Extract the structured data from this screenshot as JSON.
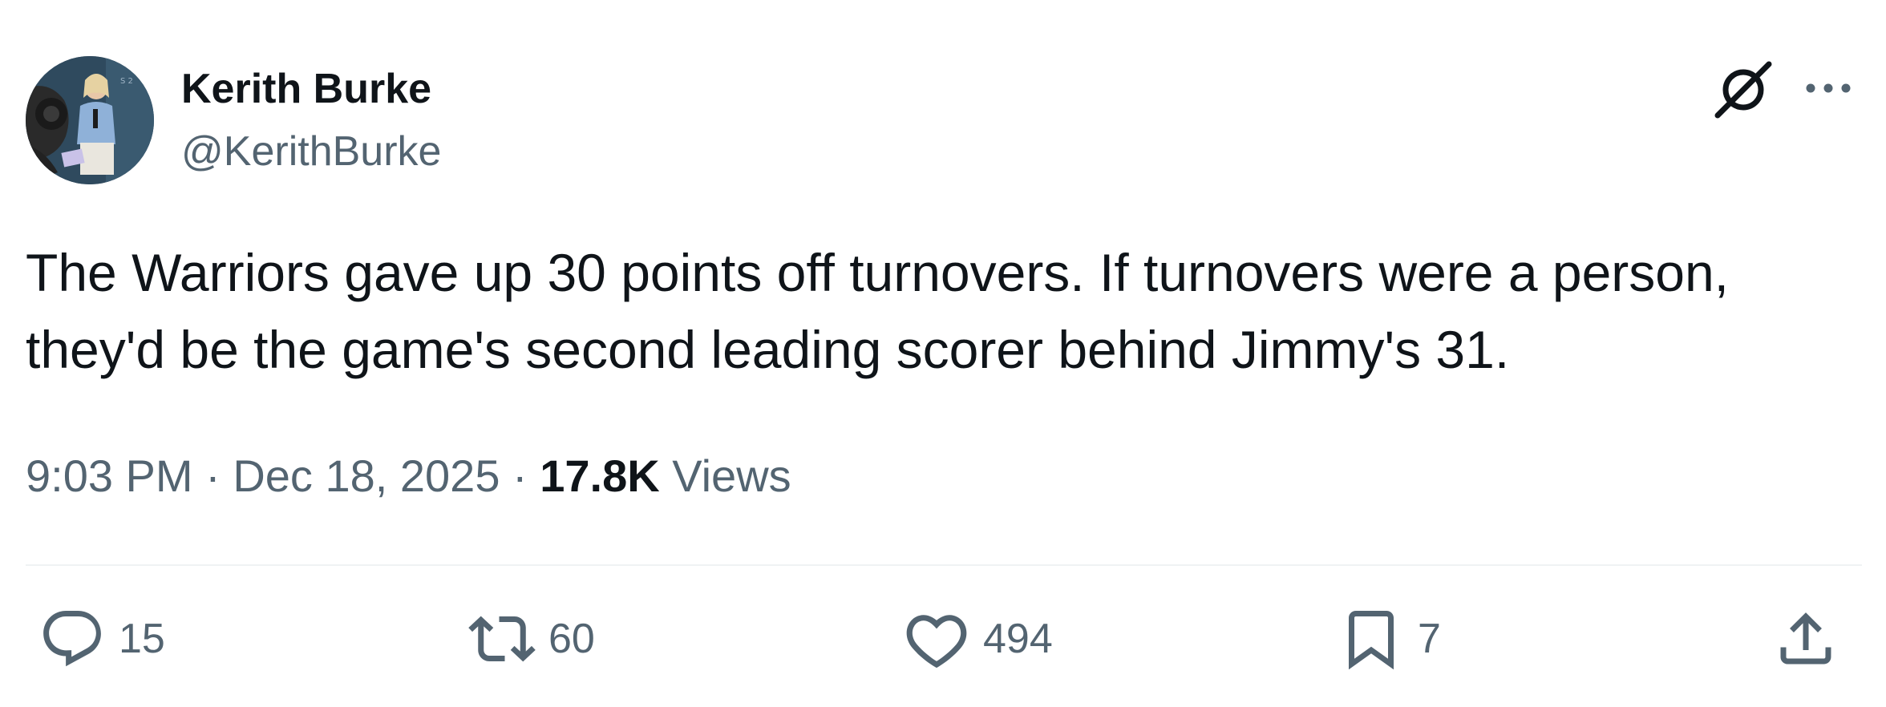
{
  "author": {
    "display_name": "Kerith Burke",
    "handle": "@KerithBurke"
  },
  "header_icons": {
    "grok": "grok-icon",
    "more": "more-options-icon"
  },
  "tweet": {
    "text": "The Warriors gave up 30 points off turnovers. If turnovers were a person, they'd be the game's second leading scorer behind Jimmy's 31.",
    "time": "9:03 PM",
    "separator": "·",
    "date": "Dec 18, 2025",
    "views_count": "17.8K",
    "views_label": "Views"
  },
  "actions": {
    "replies": "15",
    "reposts": "60",
    "likes": "494",
    "bookmarks": "7"
  },
  "colors": {
    "text_primary": "#0f1419",
    "text_secondary": "#536471",
    "divider": "#eff3f4"
  }
}
